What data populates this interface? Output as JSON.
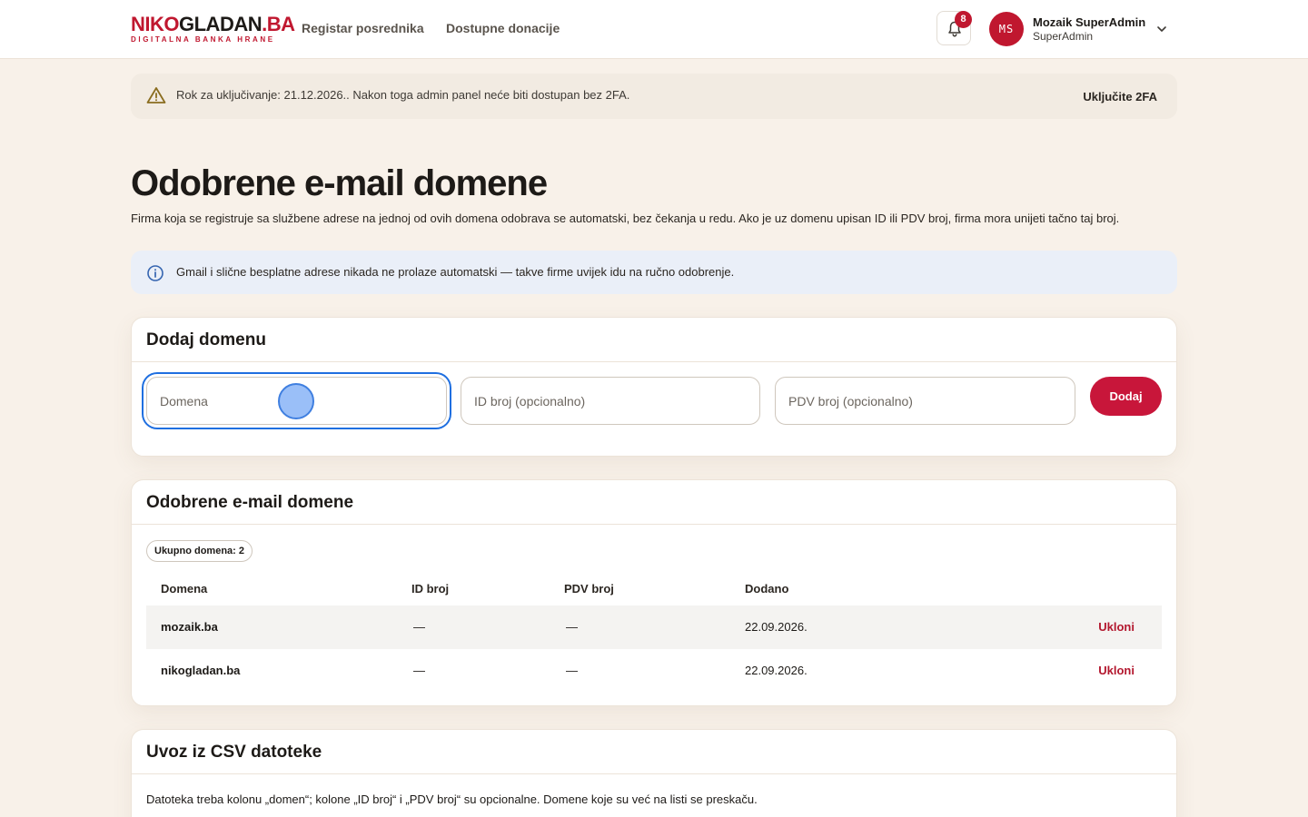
{
  "brand": {
    "logo_part1": "NIKO",
    "logo_part2": "GLADAN",
    "logo_part3": ".BA",
    "logo_sub": "DIGITALNA BANKA HRANE"
  },
  "nav": {
    "items": [
      {
        "label": "Registar posrednika"
      },
      {
        "label": "Dostupne donacije"
      }
    ]
  },
  "notifications": {
    "count": "8"
  },
  "user": {
    "initials": "MS",
    "name": "Mozaik SuperAdmin",
    "role": "SuperAdmin"
  },
  "warning": {
    "text": "Rok za uključivanje: 21.12.2026.. Nakon toga admin panel neće biti dostupan bez 2FA.",
    "action_label": "Uključite 2FA"
  },
  "page": {
    "title": "Odobrene e-mail domene",
    "description": "Firma koja se registruje sa službene adrese na jednoj od ovih domena odobrava se automatski, bez čekanja u redu. Ako je uz domenu upisan ID ili PDV broj, firma mora unijeti tačno taj broj."
  },
  "info": {
    "text": "Gmail i slične besplatne adrese nikada ne prolaze automatski — takve firme uvijek idu na ručno odobrenje."
  },
  "add_form": {
    "title": "Dodaj domenu",
    "domain_placeholder": "Domena",
    "id_placeholder": "ID broj (opcionalno)",
    "pdv_placeholder": "PDV broj (opcionalno)",
    "submit_label": "Dodaj"
  },
  "domains_table": {
    "title": "Odobrene e-mail domene",
    "count_label": "Ukupno domena: 2",
    "columns": [
      "Domena",
      "ID broj",
      "PDV broj",
      "Dodano"
    ],
    "rows": [
      {
        "domain": "mozaik.ba",
        "id": "—",
        "pdv": "—",
        "added": "22.09.2026.",
        "action": "Ukloni"
      },
      {
        "domain": "nikogladan.ba",
        "id": "—",
        "pdv": "—",
        "added": "22.09.2026.",
        "action": "Ukloni"
      }
    ]
  },
  "csv": {
    "title": "Uvoz iz CSV datoteke",
    "description": "Datoteka treba kolonu „domen“; kolone „ID broj“ i „PDV broj“ su opcionalne. Domene koje su već na listi se preskaču."
  },
  "colors": {
    "brand_red": "#c0172f",
    "focus_blue": "#1f6fe0",
    "page_bg": "#f8f1e9"
  }
}
